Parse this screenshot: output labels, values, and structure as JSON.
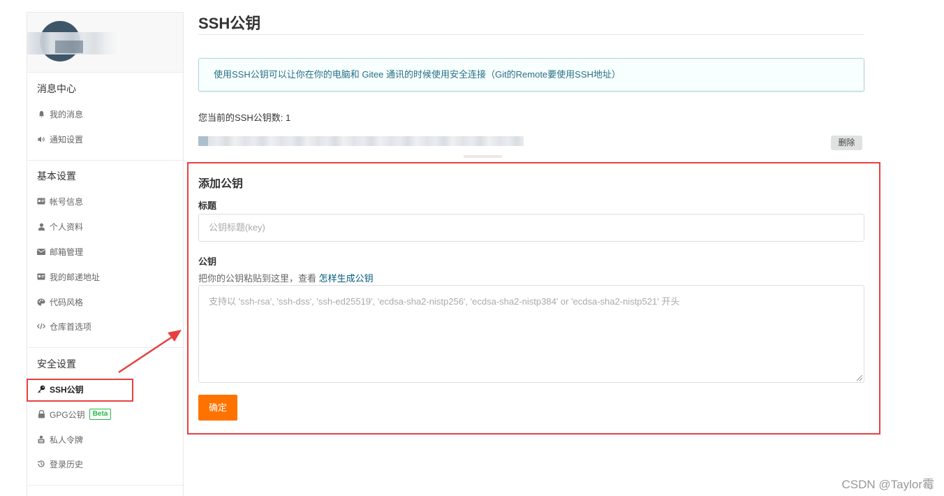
{
  "sidebar": {
    "sections": [
      {
        "title": "消息中心",
        "items": [
          {
            "icon": "bell-icon",
            "label": "我的消息"
          },
          {
            "icon": "volume-icon",
            "label": "通知设置"
          }
        ]
      },
      {
        "title": "基本设置",
        "items": [
          {
            "icon": "id-card-icon",
            "label": "帐号信息"
          },
          {
            "icon": "user-icon",
            "label": "个人资料"
          },
          {
            "icon": "mail-icon",
            "label": "邮箱管理"
          },
          {
            "icon": "address-card-icon",
            "label": "我的邮递地址"
          },
          {
            "icon": "palette-icon",
            "label": "代码风格"
          },
          {
            "icon": "code-icon",
            "label": "仓库首选项"
          }
        ]
      },
      {
        "title": "安全设置",
        "items": [
          {
            "icon": "key-icon",
            "label": "SSH公钥",
            "active": true
          },
          {
            "icon": "lock-icon",
            "label": "GPG公钥",
            "badge": "Beta"
          },
          {
            "icon": "token-icon",
            "label": "私人令牌"
          },
          {
            "icon": "history-icon",
            "label": "登录历史"
          }
        ]
      }
    ]
  },
  "main": {
    "title": "SSH公钥",
    "info": "使用SSH公钥可以让你在你的电脑和 Gitee 通讯的时候使用安全连接（Git的Remote要使用SSH地址）",
    "count_text": "您当前的SSH公钥数: 1",
    "delete_label": "删除",
    "add": {
      "title": "添加公钥",
      "title_label": "标题",
      "title_placeholder": "公钥标题(key)",
      "key_label": "公钥",
      "hint_prefix": "把你的公钥粘贴到这里，查看 ",
      "hint_link": "怎样生成公钥",
      "key_placeholder": "支持以 'ssh-rsa', 'ssh-dss', 'ssh-ed25519', 'ecdsa-sha2-nistp256', 'ecdsa-sha2-nistp384' or 'ecdsa-sha2-nistp521' 开头",
      "confirm_label": "确定"
    }
  },
  "watermark": "CSDN @Taylor霉",
  "colors": {
    "accent": "#fe7300",
    "annotation_red": "#e8403f",
    "info_bg": "#f8ffff",
    "info_text": "#276f86",
    "link": "#005980",
    "beta": "#21ba45"
  }
}
